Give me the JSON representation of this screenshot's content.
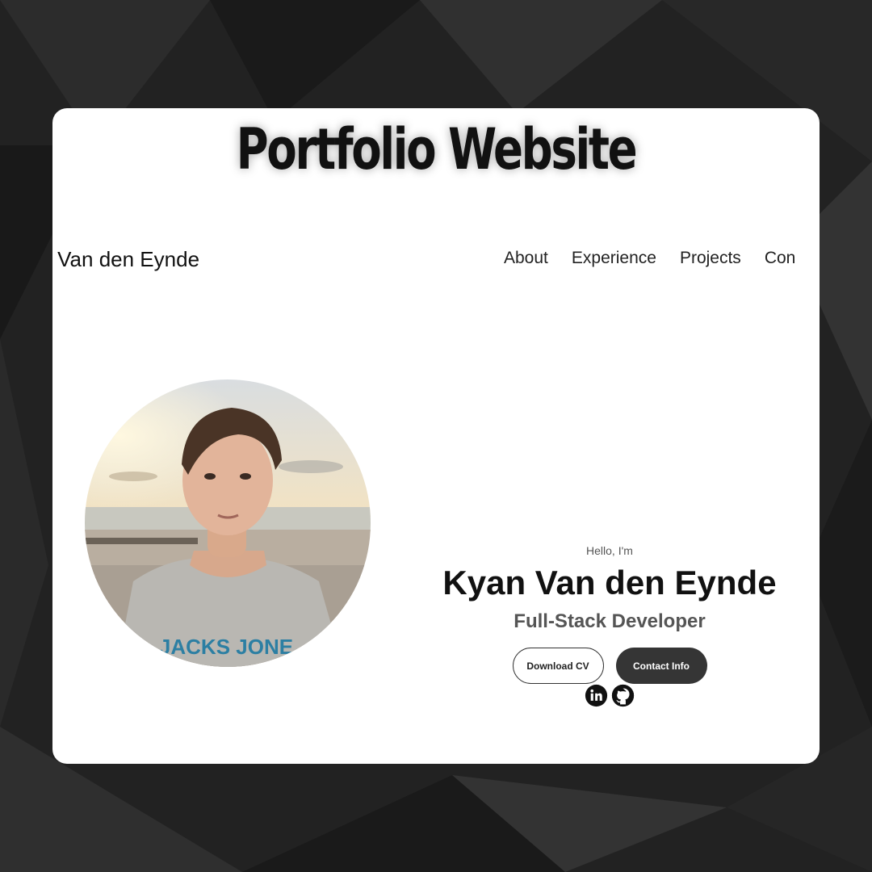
{
  "banner": {
    "title": "Portfolio Website"
  },
  "nav": {
    "logo": "an Van den Eynde",
    "links": [
      "About",
      "Experience",
      "Projects",
      "Con"
    ]
  },
  "hero": {
    "greeting": "Hello, I'm",
    "name": "Kyan Van den Eynde",
    "role": "Full-Stack Developer",
    "buttons": {
      "download": "Download CV",
      "contact": "Contact Info"
    },
    "socials": [
      "linkedin-icon",
      "github-icon"
    ],
    "photo_shirt_text": "JACKS JONE"
  },
  "colors": {
    "background": "#1f1f1f",
    "card": "#ffffff",
    "dark_button": "#353535",
    "role_text": "#555555"
  }
}
